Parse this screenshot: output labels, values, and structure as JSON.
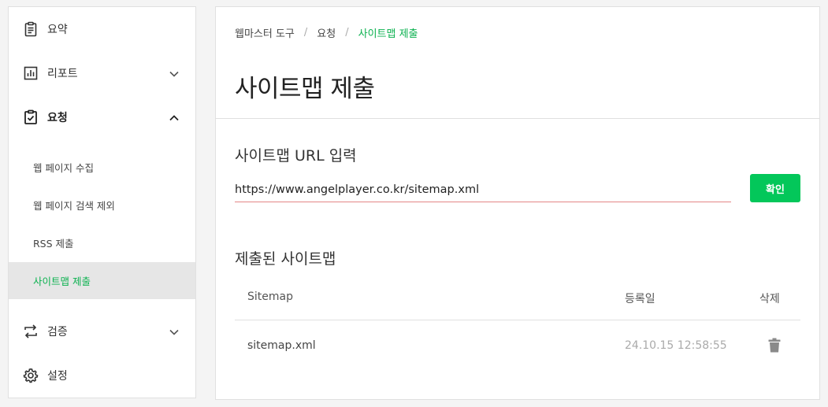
{
  "sidebar": {
    "items": [
      {
        "label": "요약",
        "icon": "clipboard-icon"
      },
      {
        "label": "리포트",
        "icon": "bar-chart-icon",
        "expanded": false
      },
      {
        "label": "요청",
        "icon": "clipboard-check-icon",
        "expanded": true,
        "children": [
          "웹 페이지 수집",
          "웹 페이지 검색 제외",
          "RSS 제출",
          "사이트맵 제출"
        ],
        "active_child": "사이트맵 제출"
      },
      {
        "label": "검증",
        "icon": "swap-arrows-icon",
        "expanded": false
      },
      {
        "label": "설정",
        "icon": "gear-icon"
      }
    ]
  },
  "breadcrumb": [
    "웹마스터 도구",
    "요청",
    "사이트맵 제출"
  ],
  "page_title": "사이트맵 제출",
  "url_section": {
    "label": "사이트맵 URL 입력",
    "input_value": "https://www.angelplayer.co.kr/sitemap.xml",
    "confirm_label": "확인"
  },
  "submitted_section": {
    "label": "제출된 사이트맵",
    "columns": [
      "Sitemap",
      "등록일",
      "삭제"
    ],
    "rows": [
      {
        "sitemap": "sitemap.xml",
        "date": "24.10.15 12:58:55",
        "delete_icon": "trash-icon"
      }
    ]
  },
  "colors": {
    "accent": "#03c75a",
    "active_text": "#0bb14f",
    "input_underline": "#e38686"
  }
}
